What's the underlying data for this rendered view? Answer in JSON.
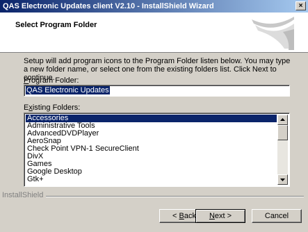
{
  "window": {
    "title": "QAS Electronic Updates client V2.10 - InstallShield Wizard",
    "close_glyph": "×"
  },
  "header": {
    "heading": "Select Program Folder"
  },
  "intro_text": "Setup will add program icons to the Program Folder listen below.  You may type a new folder name, or select one from the existing folders list.  Click Next to continue.",
  "program_folder": {
    "label_pre": "",
    "label_key": "P",
    "label_post": "rogram Folder:",
    "value": "QAS Electronic Updates"
  },
  "existing_folders": {
    "label_pre": "E",
    "label_key": "x",
    "label_post": "isting Folders:",
    "items": [
      "Accessories",
      "Administrative Tools",
      "AdvancedDVDPlayer",
      "AeroSnap",
      "Check Point VPN-1 SecureClient",
      "DivX",
      "Games",
      "Google Desktop",
      "Gtk+"
    ],
    "selected_index": 0
  },
  "footer": {
    "brand": "InstallShield"
  },
  "buttons": {
    "back_pre": "< ",
    "back_key": "B",
    "back_post": "ack",
    "next_key": "N",
    "next_post": "ext >",
    "cancel": "Cancel"
  },
  "colors": {
    "highlight": "#0a246a",
    "face": "#d4d0c8"
  }
}
